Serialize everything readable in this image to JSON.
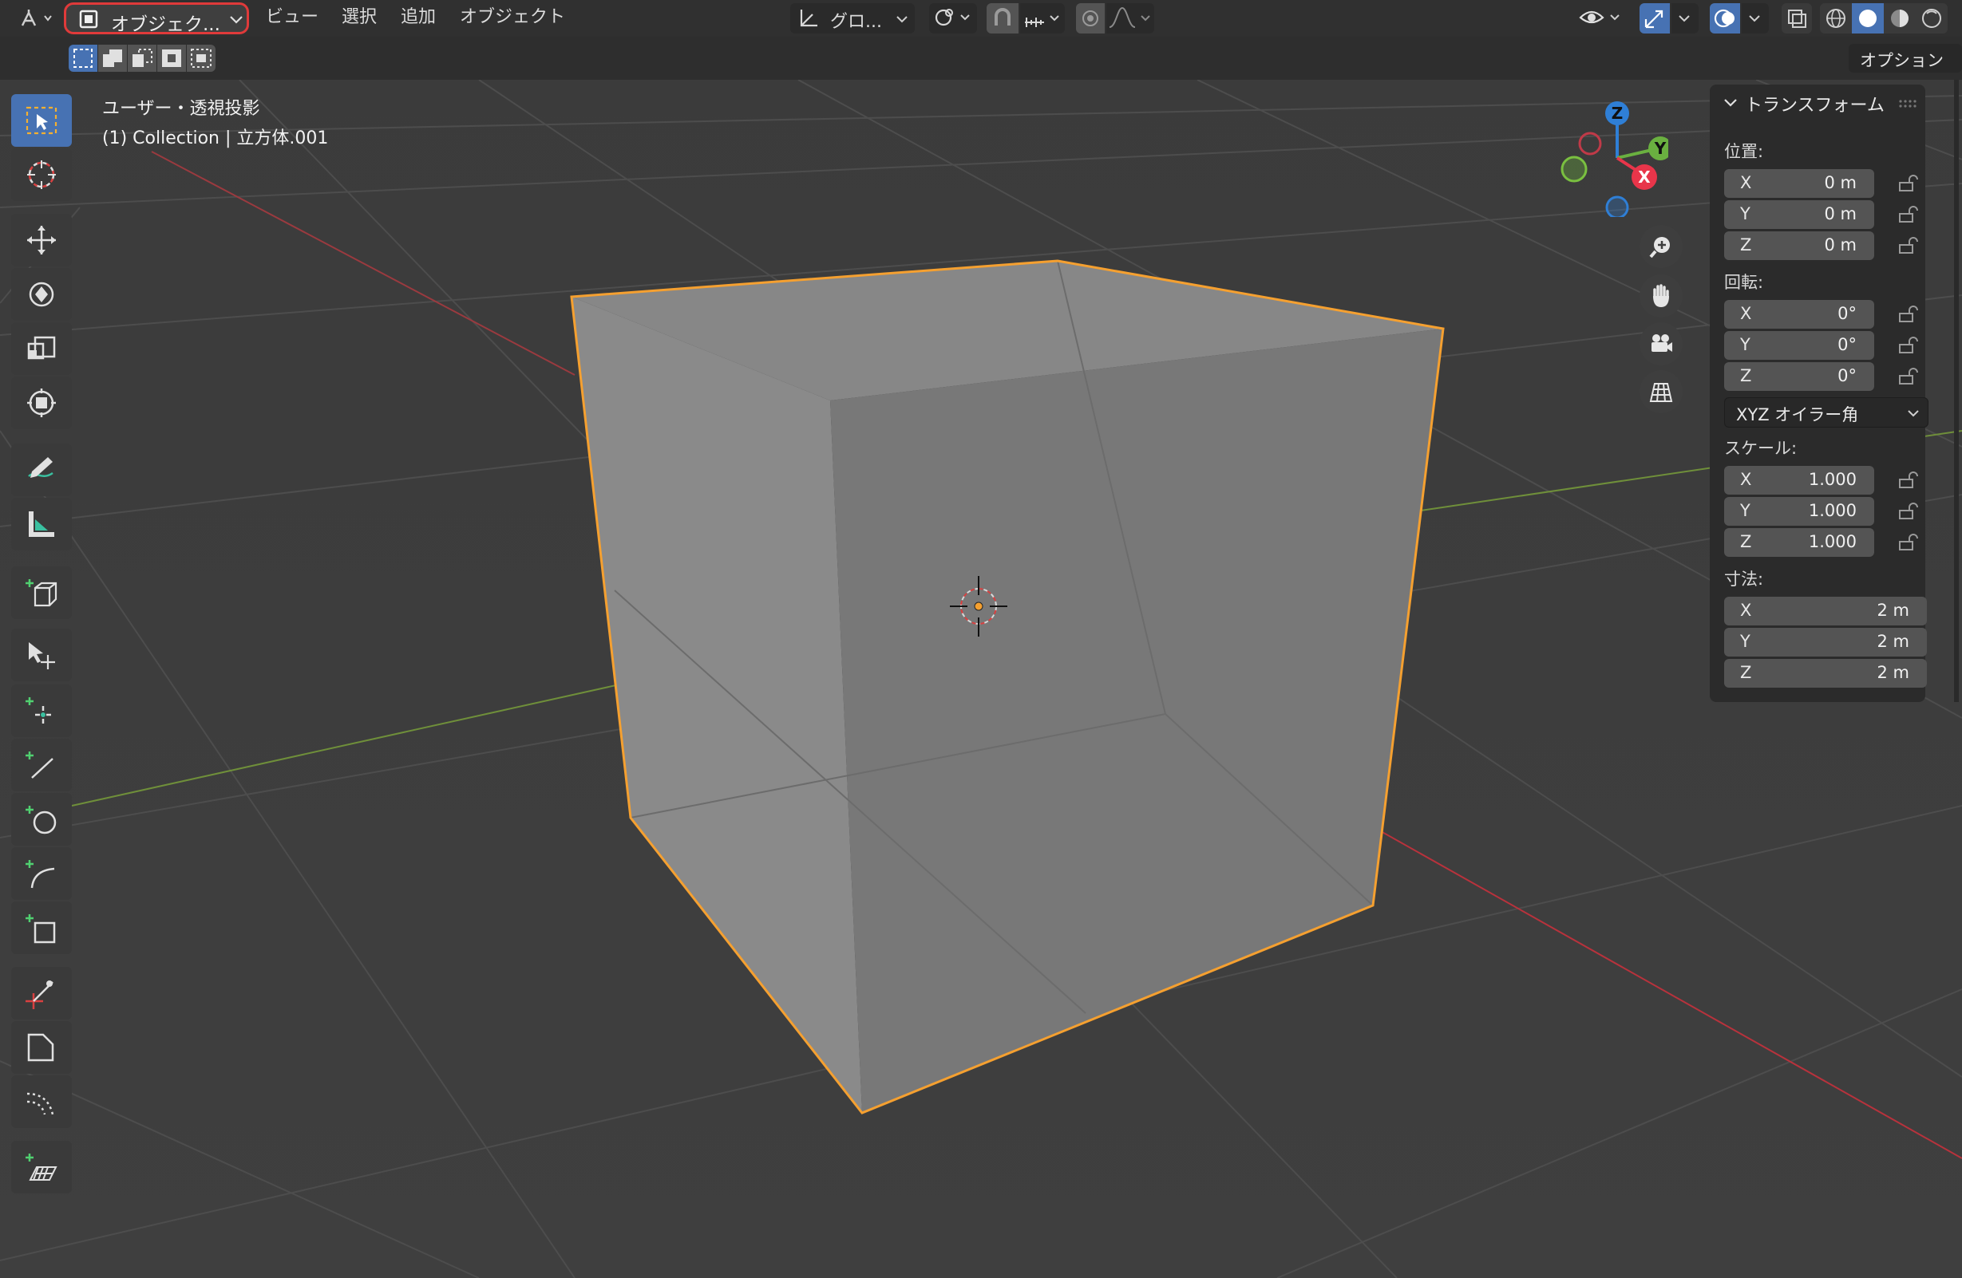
{
  "header": {
    "mode_selector": "オブジェク...",
    "menu": [
      "ビュー",
      "選択",
      "追加",
      "オブジェクト"
    ],
    "transform_orientation": "グロ...",
    "options_button": "オプション"
  },
  "viewport": {
    "view_name": "ユーザー・透視投影",
    "object_info": "(1) Collection | 立方体.001",
    "gizmo_axes": [
      "Z",
      "Y",
      "X"
    ]
  },
  "npanel": {
    "title": "トランスフォーム",
    "location": {
      "label": "位置:",
      "x": "0 m",
      "y": "0 m",
      "z": "0 m"
    },
    "rotation": {
      "label": "回転:",
      "x": "0°",
      "y": "0°",
      "z": "0°"
    },
    "rotation_mode": "XYZ オイラー角",
    "scale": {
      "label": "スケール:",
      "x": "1.000",
      "y": "1.000",
      "z": "1.000"
    },
    "dimensions": {
      "label": "寸法:",
      "x": "2 m",
      "y": "2 m",
      "z": "2 m"
    },
    "axis_labels": {
      "x": "X",
      "y": "Y",
      "z": "Z"
    }
  },
  "colors": {
    "selection_outline": "#f5a030",
    "active_tool": "#4772b3",
    "mode_highlight": "#e03a3a"
  }
}
